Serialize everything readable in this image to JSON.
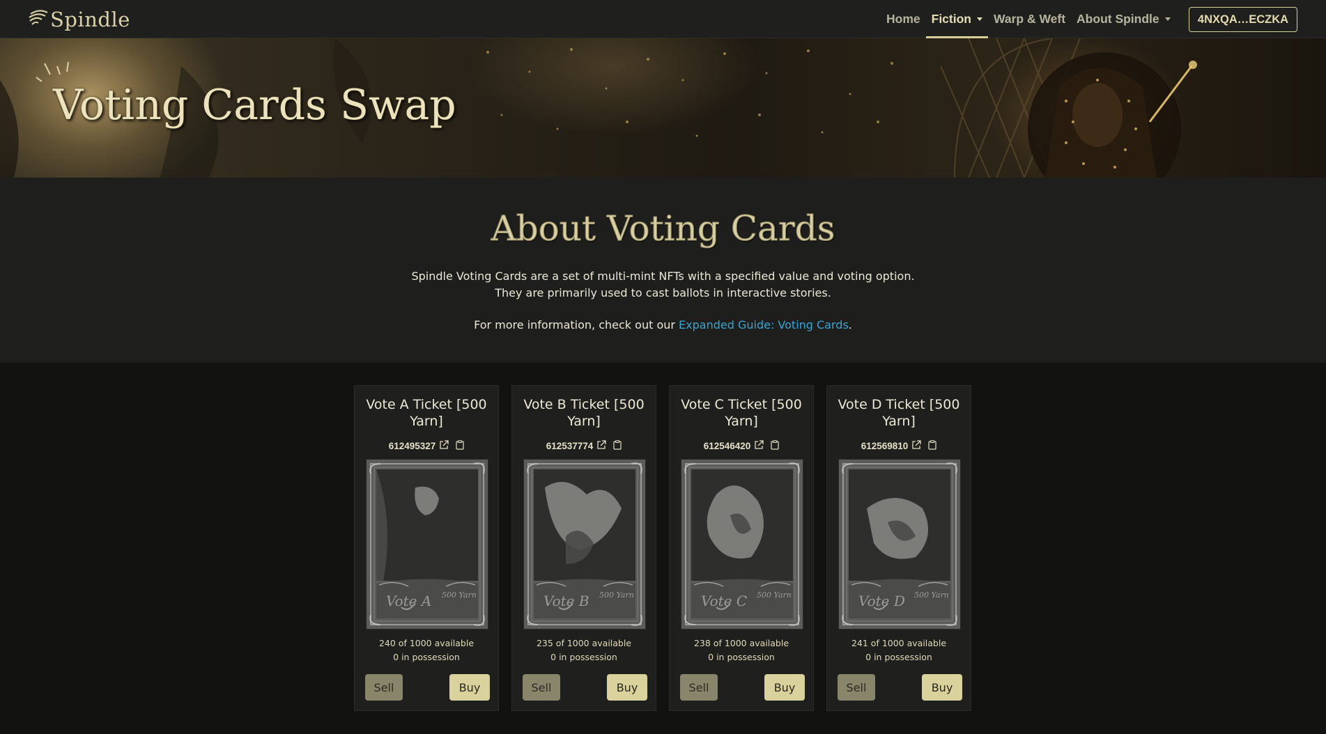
{
  "navbar": {
    "brand": "Spindle",
    "links": [
      {
        "label": "Home",
        "dropdown": false,
        "active": false
      },
      {
        "label": "Fiction",
        "dropdown": true,
        "active": true
      },
      {
        "label": "Warp & Weft",
        "dropdown": false,
        "active": false
      },
      {
        "label": "About Spindle",
        "dropdown": true,
        "active": false
      }
    ],
    "wallet_label": "4NXQA…ECZKA"
  },
  "banner": {
    "title": "Voting Cards Swap"
  },
  "about": {
    "title": "About Voting Cards",
    "description": "Spindle Voting Cards are a set of multi-mint NFTs with a specified value and voting option. They are primarily used to cast ballots in interactive stories.",
    "more_prefix": "For more information, check out our ",
    "more_link": "Expanded Guide: Voting Cards",
    "more_suffix": "."
  },
  "cards": [
    {
      "title": "Vote A Ticket [500 Yarn]",
      "asset_id": "612495327",
      "art_label": "Vote A",
      "art_value": "500 Yarn",
      "available": "240 of 1000 available",
      "possession": "0 in possession",
      "sell_label": "Sell",
      "buy_label": "Buy"
    },
    {
      "title": "Vote B Ticket [500 Yarn]",
      "asset_id": "612537774",
      "art_label": "Vote B",
      "art_value": "500 Yarn",
      "available": "235 of 1000 available",
      "possession": "0 in possession",
      "sell_label": "Sell",
      "buy_label": "Buy"
    },
    {
      "title": "Vote C Ticket [500 Yarn]",
      "asset_id": "612546420",
      "art_label": "Vote C",
      "art_value": "500 Yarn",
      "available": "238 of 1000 available",
      "possession": "0 in possession",
      "sell_label": "Sell",
      "buy_label": "Buy"
    },
    {
      "title": "Vote D Ticket [500 Yarn]",
      "asset_id": "612569810",
      "art_label": "Vote D",
      "art_value": "500 Yarn",
      "available": "241 of 1000 available",
      "possession": "0 in possession",
      "sell_label": "Sell",
      "buy_label": "Buy"
    }
  ],
  "icons": {
    "brand": "spindle-logo-icon",
    "external": "external-link-icon",
    "copy": "clipboard-icon"
  },
  "colors": {
    "page_bg": "#121311",
    "navbar_bg": "#1f201d",
    "accent_gold": "#d9d29c",
    "link_blue": "#35a7d6",
    "sell_bg": "#88856a"
  }
}
